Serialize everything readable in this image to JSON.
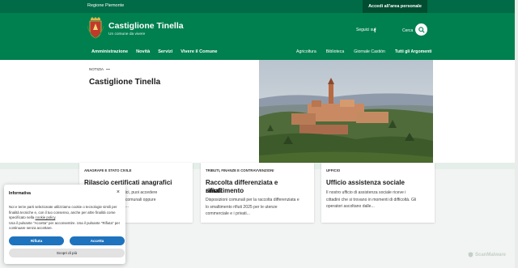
{
  "topbar": {
    "region": "Regione Piemonte",
    "login": "Accedi all'area personale"
  },
  "header": {
    "title": "Castiglione Tinella",
    "tagline": "Un comune da vivere",
    "follow": "Seguici su",
    "search_label": "Cerca"
  },
  "nav": {
    "main": [
      "Amministrazione",
      "Novità",
      "Servizi",
      "Vivere il Comune"
    ],
    "secondary": [
      "Agricoltura",
      "Biblioteca",
      "Giornale Castión"
    ],
    "all_topics": "Tutti gli Argomenti"
  },
  "hero": {
    "badge": "NOTIZIA",
    "title": "Castiglione Tinella"
  },
  "cards": [
    {
      "category": "ANAGRAFE E STATO CIVILE",
      "title": "Rilascio certificati anagrafici",
      "lines": [
        "Per i certificati anagrafici, puoi accedere",
        "direttamente agli uffici comunali oppure",
        "richiederli on-line della..."
      ]
    },
    {
      "category": "TRIBUTI, FINANZE E CONTRAVVENZIONI",
      "title_lines": [
        "Raccolta differenziata e smaltimento",
        "rifiuti"
      ],
      "lines": [
        "Disposizioni comunali per la raccolta differenziata e",
        "lo smaltimento rifiuti 2025 per le utenze",
        "commerciale e i privati..."
      ]
    },
    {
      "category": "UFFICIO",
      "title": "Ufficio assistenza sociale",
      "lines": [
        "Il nostro ufficio di assistenza sociale riceve i",
        "cittadini che si trovano in momenti di difficoltà. Gli",
        "operatori ascoltano dalle..."
      ]
    }
  ],
  "cookie": {
    "title": "Informativa",
    "close": "×",
    "text_lines": [
      "Noi e terze parti selezionate utilizziamo cookie o tecnologie simili per",
      "finalità tecniche e, con il tuo consenso, anche per altre finalità come",
      "specificato nella",
      "cookie policy",
      "Usa il pulsante \"Accetta\" per acconsentire. Usa il pulsante \"Rifiuta\" per",
      "continuare senza accettare."
    ],
    "deny": "Rifiuta",
    "accept": "Accetta",
    "more": "Scopri di più"
  },
  "watermark": "ScanMalware",
  "colors": {
    "primary": "#00804f",
    "topbar": "#006b46",
    "button": "#1e73be"
  }
}
